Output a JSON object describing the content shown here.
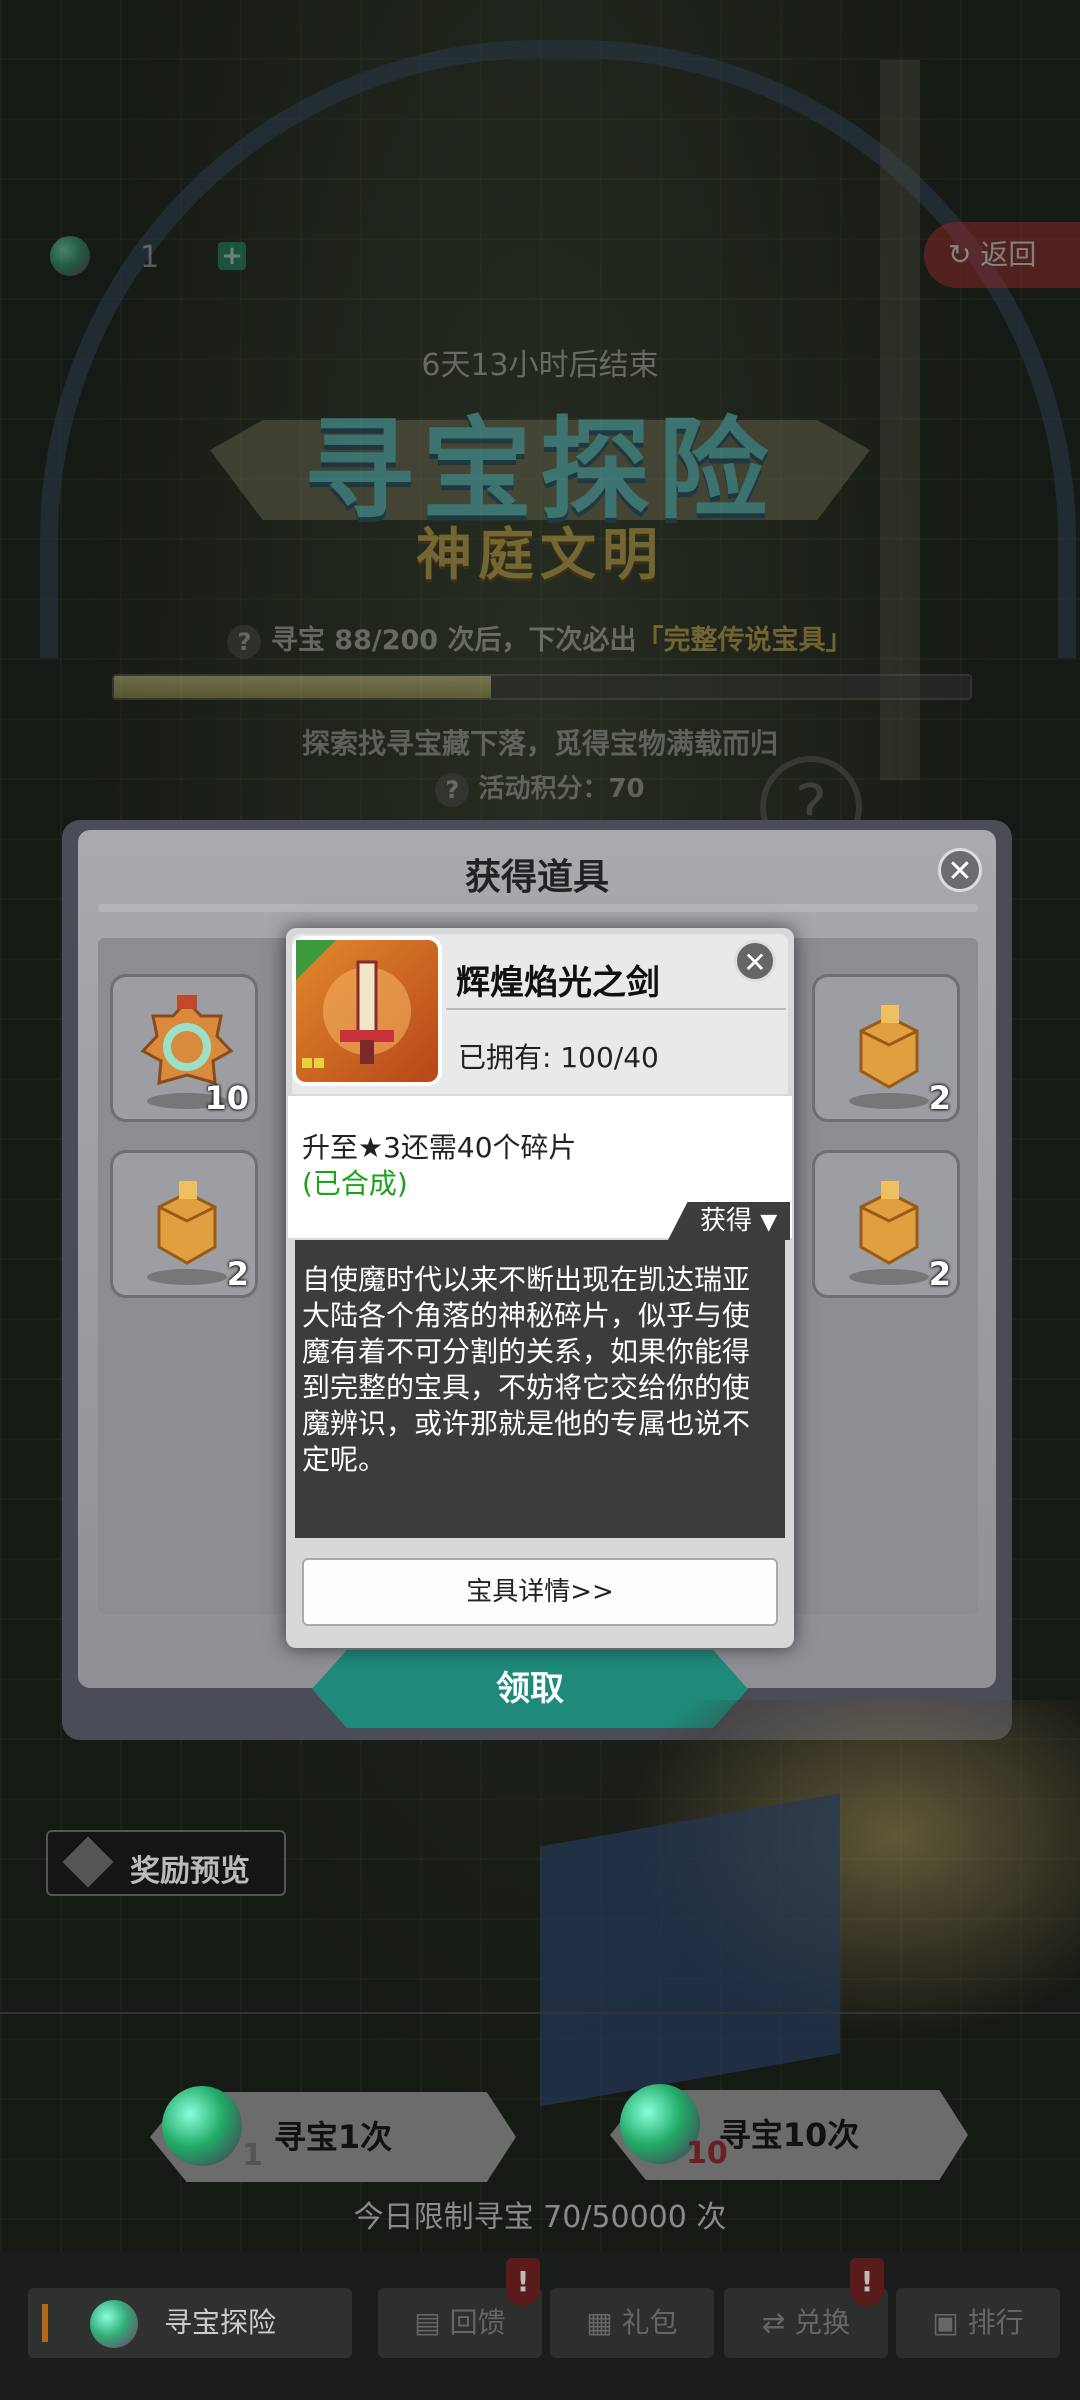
{
  "topbar": {
    "currency_count": "1",
    "add_label": "+",
    "back_label": "返回",
    "back_icon": "↻"
  },
  "event": {
    "countdown": "6天13小时后结束",
    "title": "寻宝探险",
    "subtitle": "神庭文明",
    "pity_prefix": "寻宝 88/200 次后，下次必出",
    "pity_highlight": "「完整传说宝具」",
    "progress": 0.44,
    "description": "探索找寻宝藏下落，觅得宝物满载而归",
    "points": "活动积分：70"
  },
  "dialog": {
    "title": "获得道具",
    "items": [
      {
        "icon": "medal-icon",
        "count": "10"
      },
      {
        "icon": "cube-fragment-icon",
        "count": "2"
      },
      {
        "icon": "cube-fragment-icon",
        "count": "2"
      },
      {
        "icon": "cube-fragment-icon",
        "count": "2"
      }
    ],
    "claim_label": "领取"
  },
  "popup": {
    "item_name": "辉煌焰光之剑",
    "owned": "已拥有: 100/40",
    "upgrade": "升至★3还需40个碎片",
    "synthesized": "(已合成)",
    "obtain_label": "获得",
    "description": "自使魔时代以来不断出现在凯达瑞亚大陆各个角落的神秘碎片，似乎与使魔有着不可分割的关系，如果你能得到完整的宝具，不妨将它交给你的使魔辨识，或许那就是他的专属也说不定呢。",
    "detail_label": "宝具详情>>"
  },
  "reward_preview": "奖励预览",
  "hunt": {
    "once_label": "寻宝1次",
    "once_cost": "1",
    "ten_label": "寻宝10次",
    "ten_cost": "10",
    "limit": "今日限制寻宝 70/50000 次"
  },
  "nav": {
    "tabs": [
      "寻宝探险",
      "回馈",
      "礼包",
      "兑换",
      "排行"
    ],
    "badge": "!"
  },
  "colors": {
    "accent_teal": "#1f8a7c",
    "title_cyan": "#5fd3d6",
    "highlight_gold": "#d9b44a",
    "success_green": "#1ea21e"
  }
}
